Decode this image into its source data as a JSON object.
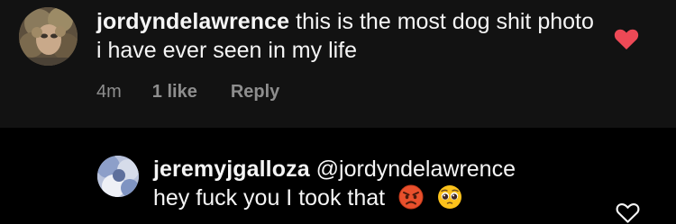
{
  "comment": {
    "username": "jordyndelawrence",
    "text": "this is the most dog shit photo i have ever seen in my life",
    "time": "4m",
    "likes": "1 like",
    "reply_label": "Reply",
    "liked": true,
    "heart_color": "#ed4956"
  },
  "reply": {
    "username": "jeremyjgalloza",
    "mention": "@jordyndelawrence",
    "text": "hey fuck you I took that",
    "emojis": [
      "angry-face-emoji",
      "pleading-face-emoji"
    ],
    "liked": false
  },
  "colors": {
    "background": "#000000",
    "comment_background": "#121212",
    "text_primary": "#f5f5f5",
    "text_secondary": "#8e8e8e",
    "heart_liked": "#ed4956"
  }
}
